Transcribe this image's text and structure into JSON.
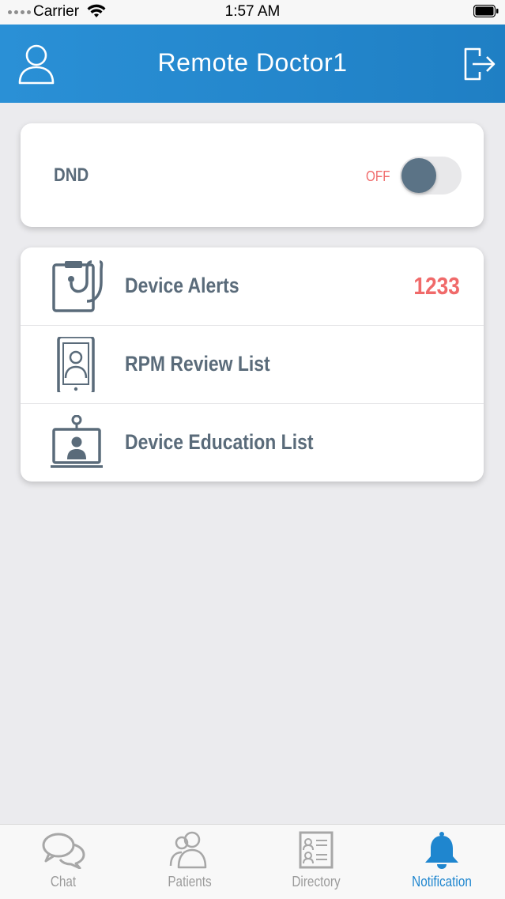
{
  "status_bar": {
    "carrier": "Carrier",
    "time": "1:57 AM"
  },
  "header": {
    "title": "Remote Doctor1",
    "left_icon": "user-icon",
    "right_icon": "logout-icon"
  },
  "dnd": {
    "label": "DND",
    "state_label": "OFF",
    "enabled": false
  },
  "menu": {
    "items": [
      {
        "label": "Device Alerts",
        "icon": "stethoscope-tablet-icon",
        "count": "1233"
      },
      {
        "label": "RPM Review List",
        "icon": "phone-user-icon"
      },
      {
        "label": "Device Education List",
        "icon": "video-monitor-icon"
      }
    ]
  },
  "tabbar": {
    "tabs": [
      {
        "label": "Chat",
        "icon": "chat-icon",
        "active": false
      },
      {
        "label": "Patients",
        "icon": "patients-icon",
        "active": false
      },
      {
        "label": "Directory",
        "icon": "directory-icon",
        "active": false
      },
      {
        "label": "Notification",
        "icon": "bell-icon",
        "active": true
      }
    ]
  },
  "colors": {
    "header": "#1f86cf",
    "accent_red": "#f06a6a",
    "text_slate": "#5a6b7a",
    "tab_active": "#1f86cf"
  }
}
